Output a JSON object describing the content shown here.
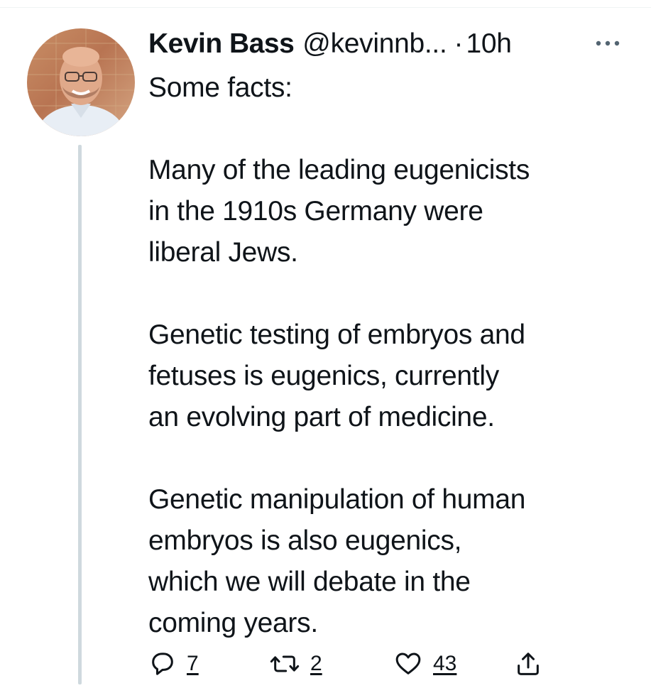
{
  "tweet": {
    "author_name": "Kevin Bass",
    "author_handle": "@kevinnb...",
    "separator": "·",
    "timestamp": "10h",
    "paragraphs": [
      "Some facts:",
      "Many of the leading eugenicists in the 1910s Germany were liberal Jews.",
      "Genetic testing of embryos and fetuses is eugenics, currently an evolving part of medicine.",
      "Genetic manipulation of human embryos is also eugenics, which we will debate in the coming years."
    ],
    "paragraph_lines": [
      [
        "Some facts:"
      ],
      [
        "Many of the leading eugenicists",
        "in the 1910s Germany were",
        "liberal Jews."
      ],
      [
        "Genetic testing of embryos and",
        "fetuses is eugenics, currently",
        "an evolving part of medicine."
      ],
      [
        "Genetic manipulation of human",
        "embryos is also eugenics,",
        "which we will debate in the",
        "coming years."
      ]
    ]
  },
  "actions": {
    "reply_count": "7",
    "retweet_count": "2",
    "like_count": "43"
  },
  "icons": {
    "more": "more-horizontal-icon",
    "reply": "reply-icon",
    "retweet": "retweet-icon",
    "like": "heart-icon",
    "share": "share-icon"
  },
  "colors": {
    "text": "#0f1419",
    "muted": "#536471",
    "thread_line": "#cfd9de"
  }
}
